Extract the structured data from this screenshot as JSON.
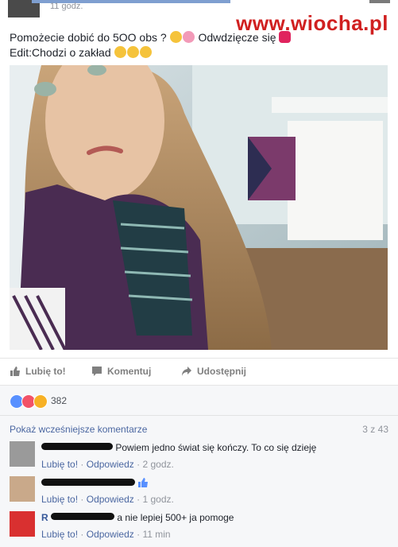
{
  "header": {
    "time": "11 godz."
  },
  "watermark": "www.wiocha.pl",
  "post": {
    "line1": "Pomożecie dobić do 5OO obs ?",
    "line1_suffix": "Odwdzięcze się",
    "line2": "Edit:Chodzi o zakład"
  },
  "actions": {
    "like": "Lubię to!",
    "comment": "Komentuj",
    "share": "Udostępnij"
  },
  "reactions": {
    "count": "382"
  },
  "comments_section": {
    "show_previous": "Pokaż wcześniejsze komentarze",
    "paging": "3 z 43",
    "items": [
      {
        "name": "",
        "text": "Powiem jedno świat się kończy. To co się dzieję",
        "like": "Lubię to!",
        "reply": "Odpowiedz",
        "time": "2 godz."
      },
      {
        "name": "",
        "text": "",
        "like": "Lubię to!",
        "reply": "Odpowiedz",
        "time": "1 godz."
      },
      {
        "name": "R",
        "text": "a nie lepiej 500+ ja pomoge",
        "like": "Lubię to!",
        "reply": "Odpowiedz",
        "time": "11 min"
      }
    ],
    "separator": "·"
  },
  "colors": {
    "link": "#4b67a1",
    "like_blue": "#5890ff",
    "love_red": "#f25268",
    "haha_yellow": "#f7b125",
    "watermark_red": "#d02020"
  }
}
